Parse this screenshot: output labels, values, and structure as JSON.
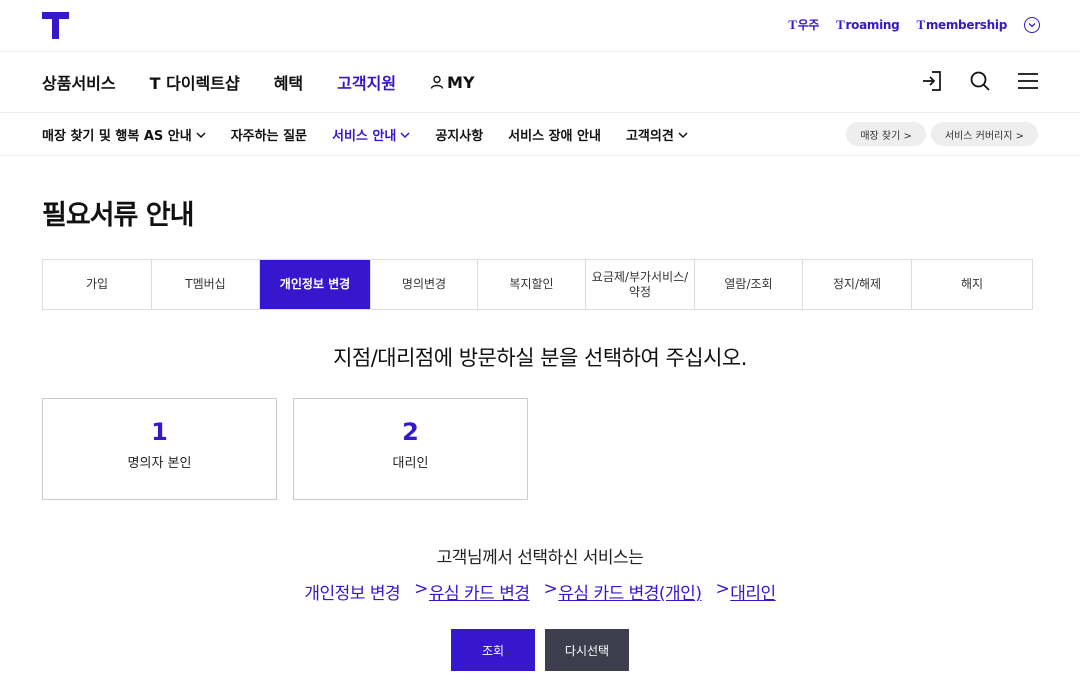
{
  "header": {
    "util_links": [
      {
        "prefix": "T",
        "label": "우주"
      },
      {
        "prefix": "T",
        "label": "roaming"
      },
      {
        "prefix": "T",
        "label": "membership"
      }
    ]
  },
  "gnb": {
    "items": [
      {
        "label": "상품서비스"
      },
      {
        "label": "T 다이렉트샵"
      },
      {
        "label": "혜택"
      },
      {
        "label": "고객지원",
        "active": true
      },
      {
        "label": "MY"
      }
    ]
  },
  "subnav": {
    "items": [
      {
        "label": "매장 찾기 및 행복 AS 안내"
      },
      {
        "label": "자주하는 질문"
      },
      {
        "label": "서비스 안내",
        "active": true
      },
      {
        "label": "공지사항"
      },
      {
        "label": "서비스 장애 안내"
      },
      {
        "label": "고객의견"
      }
    ],
    "pills": [
      {
        "label": "매장 찾기 >"
      },
      {
        "label": "서비스 커버리지 >"
      }
    ]
  },
  "page": {
    "title": "필요서류 안내",
    "tabs": [
      {
        "label": "가입"
      },
      {
        "label": "T멤버십"
      },
      {
        "label": "개인정보 변경",
        "active": true
      },
      {
        "label": "명의변경"
      },
      {
        "label": "복지할인"
      },
      {
        "label_line1": "요금제/부가서비스/",
        "label_line2": "약정"
      },
      {
        "label": "열람/조회"
      },
      {
        "label": "정지/해제"
      },
      {
        "label": "해지"
      }
    ],
    "question": "지점/대리점에 방문하실 분을 선택하여 주십시오.",
    "options": [
      {
        "number": "1",
        "label": "명의자 본인"
      },
      {
        "number": "2",
        "label": "대리인"
      }
    ],
    "summary_head": "고객님께서 선택하신 서비스는",
    "selection": {
      "first": "개인정보 변경",
      "separator": ">",
      "links": [
        "유심 카드 변경",
        "유심 카드 변경(개인)",
        "대리인"
      ]
    },
    "buttons": {
      "search": "조회",
      "reselect": "다시선택"
    }
  },
  "colors": {
    "brand": "#3617ce",
    "secondary_button": "#3d3d4d"
  }
}
